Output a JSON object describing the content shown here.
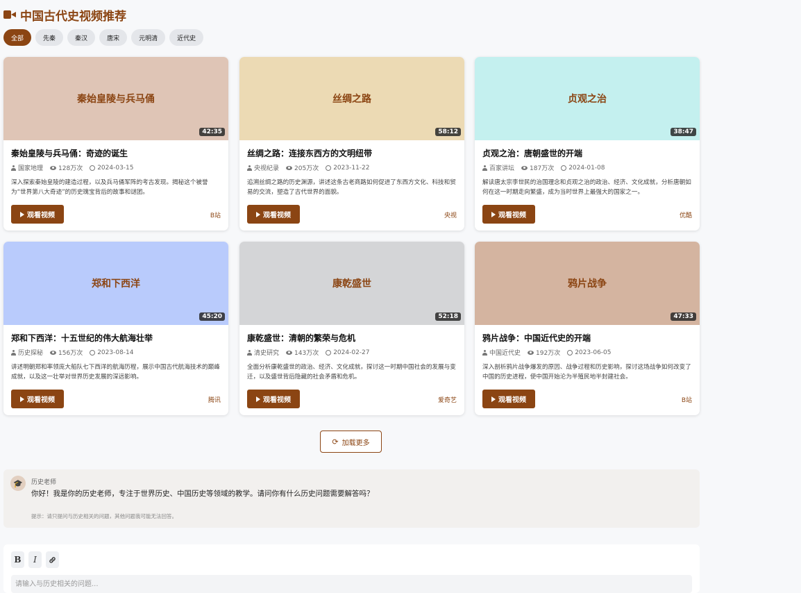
{
  "header": {
    "title": "中国古代史视频推荐",
    "icon": "video-camera-icon"
  },
  "filters": [
    "全部",
    "先秦",
    "秦汉",
    "唐宋",
    "元明清",
    "近代史"
  ],
  "videos": [
    {
      "thumb_title": "秦始皇陵与兵马俑",
      "duration": "42:35",
      "thumb_color": "#dfc5b6",
      "title": "秦始皇陵与兵马俑：奇迹的诞生",
      "author": "国家地理",
      "views": "128万次",
      "date": "2024-03-15",
      "desc": "深入探索秦始皇陵的建造过程，以及兵马俑军阵的考古发现。揭秘这个被誉为“世界第八大奇迹”的历史瑰宝背后的故事和谜团。",
      "button": "观看视频",
      "platform": "B站"
    },
    {
      "thumb_title": "丝绸之路",
      "duration": "58:12",
      "thumb_color": "#ecdab4",
      "title": "丝绸之路：连接东西方的文明纽带",
      "author": "央视纪录",
      "views": "205万次",
      "date": "2023-11-22",
      "desc": "追溯丝绸之路的历史渊源，讲述这条古老商路如何促进了东西方文化、科技和贸易的交流，塑造了古代世界的面貌。",
      "button": "观看视频",
      "platform": "央视"
    },
    {
      "thumb_title": "贞观之治",
      "duration": "38:47",
      "thumb_color": "#c4f0ef",
      "title": "贞观之治：唐朝盛世的开端",
      "author": "百家讲坛",
      "views": "187万次",
      "date": "2024-01-08",
      "desc": "解读唐太宗李世民的治国理念和贞观之治的政治、经济、文化成就，分析唐朝如何在这一时期走向繁盛，成为当时世界上最强大的国家之一。",
      "button": "观看视频",
      "platform": "优酷"
    },
    {
      "thumb_title": "郑和下西洋",
      "duration": "45:20",
      "thumb_color": "#b9cbfc",
      "title": "郑和下西洋：十五世纪的伟大航海壮举",
      "author": "历史探秘",
      "views": "156万次",
      "date": "2023-08-14",
      "desc": "讲述明朝郑和率领庞大船队七下西洋的航海历程，展示中国古代航海技术的巅峰成就，以及这一壮举对世界历史发展的深远影响。",
      "button": "观看视频",
      "platform": "腾讯"
    },
    {
      "thumb_title": "康乾盛世",
      "duration": "52:18",
      "thumb_color": "#d4d5d7",
      "title": "康乾盛世：清朝的繁荣与危机",
      "author": "清史研究",
      "views": "143万次",
      "date": "2024-02-27",
      "desc": "全面分析康乾盛世的政治、经济、文化成就，探讨这一时期中国社会的发展与变迁，以及盛世背后隐藏的社会矛盾和危机。",
      "button": "观看视频",
      "platform": "爱奇艺"
    },
    {
      "thumb_title": "鸦片战争",
      "duration": "47:33",
      "thumb_color": "#d4b4a0",
      "title": "鸦片战争：中国近代史的开端",
      "author": "中国近代史",
      "views": "192万次",
      "date": "2023-06-05",
      "desc": "深入剖析鸦片战争爆发的原因、战争过程和历史影响，探讨这场战争如何改变了中国的历史进程，使中国开始沦为半殖民地半封建社会。",
      "button": "观看视频",
      "platform": "B站"
    }
  ],
  "load_more": "加载更多",
  "chat": {
    "name": "历史老师",
    "message": "你好！我是你的历史老师，专注于世界历史、中国历史等领域的教学。请问你有什么历史问题需要解答吗？",
    "hint": "提示：请只提问与历史相关的问题，其他问题我可能无法回答。"
  },
  "composer": {
    "bold": "B",
    "italic": "I",
    "placeholder": "请输入与历史相关的问题..."
  },
  "colors": {
    "accent": "#8b4513"
  }
}
